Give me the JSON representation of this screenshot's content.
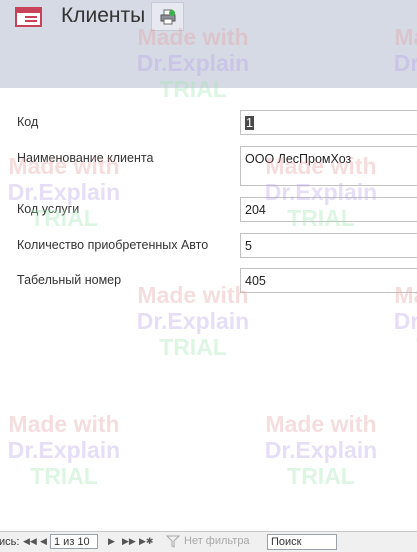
{
  "form": {
    "title": "Клиенты",
    "icon": "form-icon",
    "print_icon": "print-icon"
  },
  "fields": {
    "code": {
      "label": "Код",
      "value": "1"
    },
    "client_name": {
      "label": "Наименование клиента",
      "value": "ООО ЛесПромХоз"
    },
    "service_code": {
      "label": "Код услуги",
      "value": "204"
    },
    "cars_bought": {
      "label": "Количество приобретенных Авто",
      "value": "5"
    },
    "employee_number": {
      "label": "Табельный номер",
      "value": "405"
    }
  },
  "watermark": {
    "line1": "Made with",
    "line2": "Dr.Explain",
    "line3": "TRIAL"
  },
  "navigation": {
    "label": "ись:",
    "first": "◀◀",
    "prev": "◀",
    "record": "1 из 10",
    "next": "▶",
    "last": "▶▶",
    "new": "▶✱",
    "filter": "Нет фильтра",
    "search": "Поиск"
  },
  "colors": {
    "header_bg": "#d5dae5",
    "icon_accent": "#c8435a"
  }
}
